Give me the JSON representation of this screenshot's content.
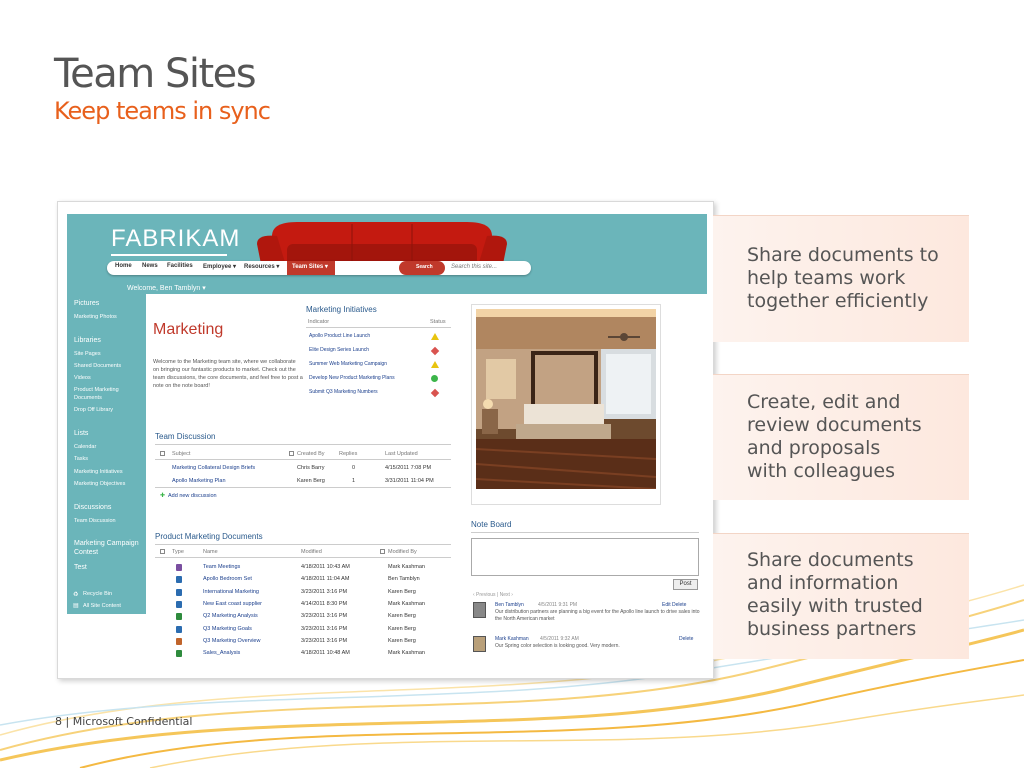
{
  "slide": {
    "title": "Team Sites",
    "subtitle": "Keep teams in sync",
    "footer_page": "8",
    "footer_sep": "|",
    "footer_text": "Microsoft Confidential"
  },
  "callouts": [
    "Share documents to\nhelp teams work\ntogether efficiently",
    "Create, edit and\nreview documents\nand proposals\nwith colleagues",
    "Share documents\nand information\neasily with trusted\nbusiness partners"
  ],
  "site": {
    "brand": "FABRIKAM",
    "nav": [
      "Home",
      "News",
      "Facilities",
      "Employee ▾",
      "Resources ▾"
    ],
    "nav_active": "Team Sites ▾",
    "search_button": "Search",
    "search_placeholder": "Search this site...",
    "welcome": "Welcome, Ben Tamblyn ▾",
    "left_nav": [
      {
        "label": "Pictures",
        "heading": true
      },
      {
        "label": "Marketing Photos",
        "heading": false
      },
      {
        "label": "Libraries",
        "heading": true
      },
      {
        "label": "Site Pages",
        "heading": false
      },
      {
        "label": "Shared Documents",
        "heading": false
      },
      {
        "label": "Videos",
        "heading": false
      },
      {
        "label": "Product Marketing",
        "heading": false
      },
      {
        "label": "Documents",
        "heading": false
      },
      {
        "label": "Drop Off Library",
        "heading": false
      },
      {
        "label": "Lists",
        "heading": true
      },
      {
        "label": "Calendar",
        "heading": false
      },
      {
        "label": "Tasks",
        "heading": false
      },
      {
        "label": "Marketing Initiatives",
        "heading": false
      },
      {
        "label": "Marketing Objectives",
        "heading": false
      },
      {
        "label": "Discussions",
        "heading": true
      },
      {
        "label": "Team Discussion",
        "heading": false
      },
      {
        "label": "Marketing Campaign",
        "heading": true
      },
      {
        "label": "Contest",
        "heading": true
      },
      {
        "label": "Test",
        "heading": true
      },
      {
        "label": "Recycle Bin",
        "heading": false
      },
      {
        "label": "All Site Content",
        "heading": false
      }
    ],
    "page_heading": "Marketing",
    "intro": "Welcome to the Marketing team site, where we collaborate on bringing our fantastic products to market. Check out the team discussions, the core documents, and feel free to post a note on the note board!",
    "initiatives": {
      "heading": "Marketing Initiatives",
      "col_indicator": "Indicator",
      "col_status": "Status",
      "rows": [
        {
          "name": "Apollo Product Line Launch",
          "status": "warning"
        },
        {
          "name": "Elite Design Series Launch",
          "status": "critical"
        },
        {
          "name": "Summer Web Marketing Campaign",
          "status": "warning"
        },
        {
          "name": "Develop New Product Marketing Plans",
          "status": "ok"
        },
        {
          "name": "Submit Q3 Marketing Numbers",
          "status": "critical"
        }
      ]
    },
    "discussion": {
      "heading": "Team Discussion",
      "cols": [
        "Subject",
        "Created By",
        "Replies",
        "Last Updated"
      ],
      "rows": [
        {
          "subject": "Marketing Collateral Design Briefs",
          "by": "Chris Barry",
          "replies": "0",
          "updated": "4/15/2011 7:08 PM"
        },
        {
          "subject": "Apollo Marketing Plan",
          "by": "Karen Berg",
          "replies": "1",
          "updated": "3/31/2011 11:04 PM"
        }
      ],
      "add_new": "Add new discussion"
    },
    "documents": {
      "heading": "Product Marketing Documents",
      "cols": [
        "Type",
        "Name",
        "Modified",
        "Modified By"
      ],
      "rows": [
        {
          "name": "Team Meetings",
          "modified": "4/18/2011 10:43 AM",
          "by": "Mark Kashman",
          "color": "#7a4fa0"
        },
        {
          "name": "Apollo Bedroom Set",
          "modified": "4/18/2011 11:04 AM",
          "by": "Ben Tamblyn",
          "color": "#2b6cb0"
        },
        {
          "name": "International Marketing",
          "modified": "3/23/2011 3:16 PM",
          "by": "Karen Berg",
          "color": "#2b6cb0"
        },
        {
          "name": "New East coast supplier",
          "modified": "4/14/2011 8:30 PM",
          "by": "Mark Kashman",
          "color": "#2b6cb0"
        },
        {
          "name": "Q2 Marketing Analysis",
          "modified": "3/23/2011 3:16 PM",
          "by": "Karen Berg",
          "color": "#2e8b3d"
        },
        {
          "name": "Q3 Marketing Goals",
          "modified": "3/23/2011 3:16 PM",
          "by": "Karen Berg",
          "color": "#2b6cb0"
        },
        {
          "name": "Q3 Marketing Overview",
          "modified": "3/23/2011 3:16 PM",
          "by": "Karen Berg",
          "color": "#c0642b"
        },
        {
          "name": "Sales_Analysis",
          "modified": "4/18/2011 10:48 AM",
          "by": "Mark Kashman",
          "color": "#2e8b3d"
        }
      ]
    },
    "noteboard": {
      "heading": "Note Board",
      "post": "Post",
      "pager": "‹ Previous  |  Next ›",
      "notes": [
        {
          "author": "Ben Tamblyn",
          "time": "4/5/2011 9:31 PM",
          "actions": "Edit  Delete",
          "text": "Our distribution partners are planning a big event for the Apollo line launch to drive sales into the North American market"
        },
        {
          "author": "Mark Kashman",
          "time": "4/5/2011 9:32 AM",
          "actions": "Delete",
          "text": "Our Spring color selection is looking good. Very modern."
        }
      ]
    }
  },
  "colors": {
    "accent_orange": "#e8601c",
    "site_teal": "#6bb5ba",
    "site_red": "#c0392b"
  }
}
